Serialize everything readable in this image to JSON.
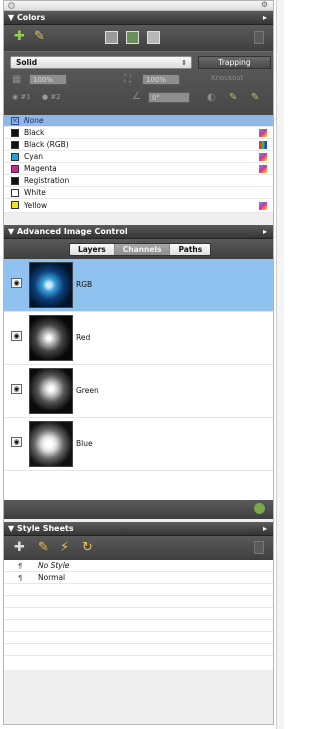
{
  "colors_panel": {
    "title": "Colors",
    "fill_type": "Solid",
    "trapping_button": "Trapping",
    "shade_left": "100%",
    "shade_right": "100%",
    "knockout_label": "Knockout",
    "angle_value": "0°",
    "radio_1": "#1",
    "radio_2": "#2",
    "colors": [
      {
        "name": "None",
        "swatch": "#ffffff"
      },
      {
        "name": "Black",
        "swatch": "#111111"
      },
      {
        "name": "Black (RGB)",
        "swatch": "#111111"
      },
      {
        "name": "Cyan",
        "swatch": "#1ca4d6"
      },
      {
        "name": "Magenta",
        "swatch": "#d02592"
      },
      {
        "name": "Registration",
        "swatch": "#111111"
      },
      {
        "name": "White",
        "swatch": "#ffffff"
      },
      {
        "name": "Yellow",
        "swatch": "#f4e31c"
      }
    ]
  },
  "image_panel": {
    "title": "Advanced Image Control",
    "tabs": [
      "Layers",
      "Channels",
      "Paths"
    ],
    "channels": [
      "RGB",
      "Red",
      "Green",
      "Blue"
    ]
  },
  "styles_panel": {
    "title": "Style Sheets",
    "items": [
      "No Style",
      "Normal"
    ]
  },
  "colors": {
    "selection": "#8fb8e6",
    "channel_selection": "#8fc2ef",
    "header_bg": "#3f3f3f",
    "accent_green": "#7aa84a"
  }
}
